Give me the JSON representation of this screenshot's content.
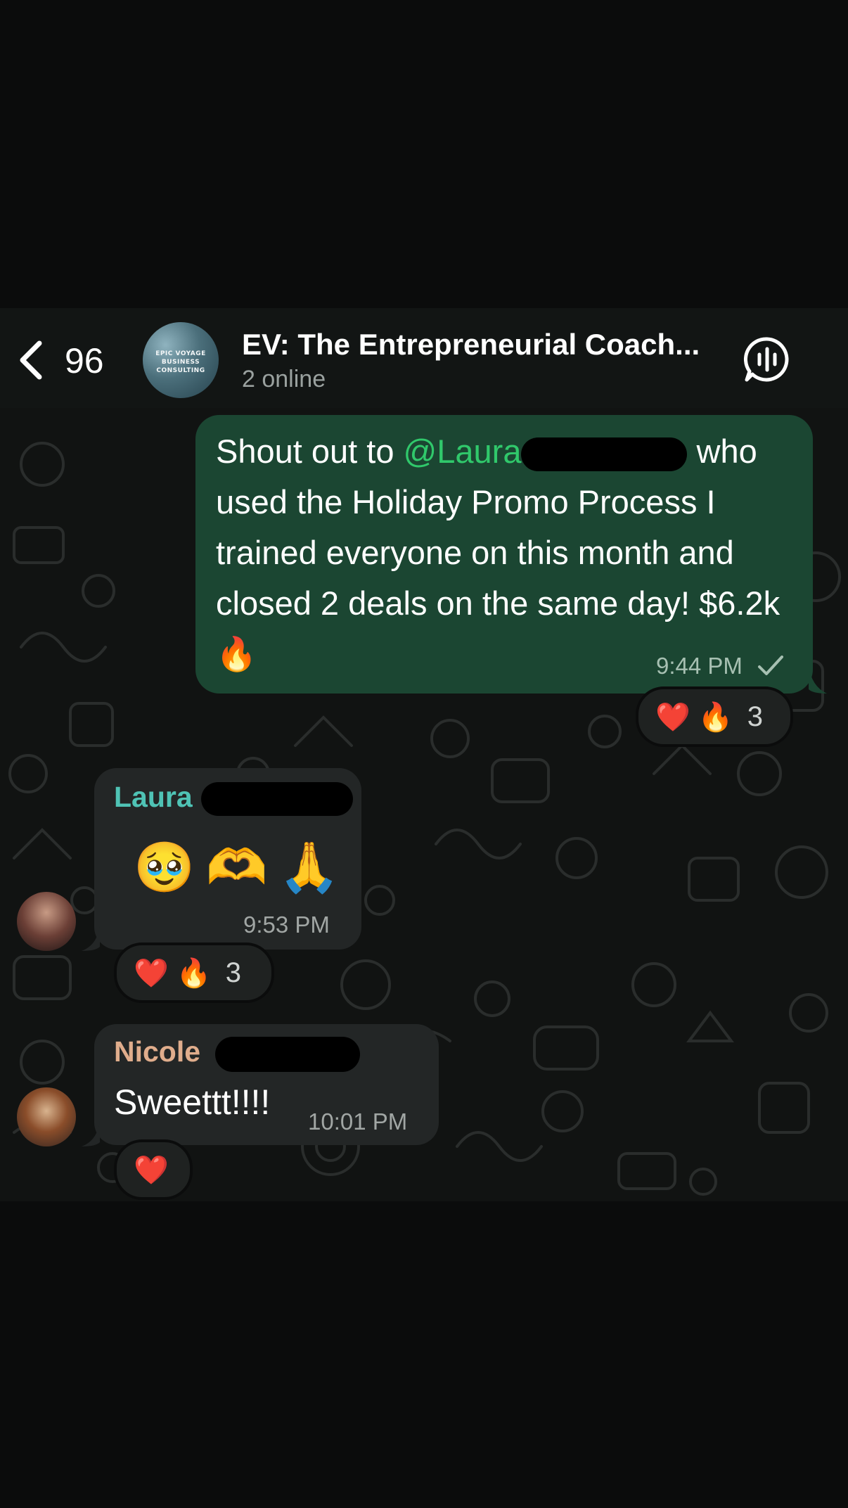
{
  "header": {
    "back_count": "96",
    "group_avatar_text": [
      "EPIC VOYAGE",
      "BUSINESS",
      "CONSULTING"
    ],
    "title": "EV: The Entrepreneurial Coach...",
    "subtitle": "2 online"
  },
  "messages": {
    "outgoing": {
      "text_before_mention": "Shout out to ",
      "mention": "@Laura",
      "text_after_mention": " who used the Holiday Promo Process I trained everyone on this month and closed 2 deals on the same day! $6.2k 🔥",
      "time": "9:44 PM",
      "reactions": {
        "emojis": "❤️  🔥",
        "count": "3"
      }
    },
    "laura": {
      "sender": "Laura",
      "content": "🥹🫶🙏",
      "time": "9:53 PM",
      "reactions": {
        "emojis": "❤️  🔥",
        "count": "3"
      }
    },
    "nicole": {
      "sender": "Nicole",
      "content": "Sweettt!!!!",
      "time": "10:01 PM",
      "reactions": {
        "emojis": "❤️"
      }
    }
  },
  "colors": {
    "outgoing_bubble": "#1b4632",
    "incoming_bubble": "#232626",
    "mention": "#30c86b",
    "laura_name": "#4fc3b5",
    "nicole_name": "#e0ad8c"
  }
}
